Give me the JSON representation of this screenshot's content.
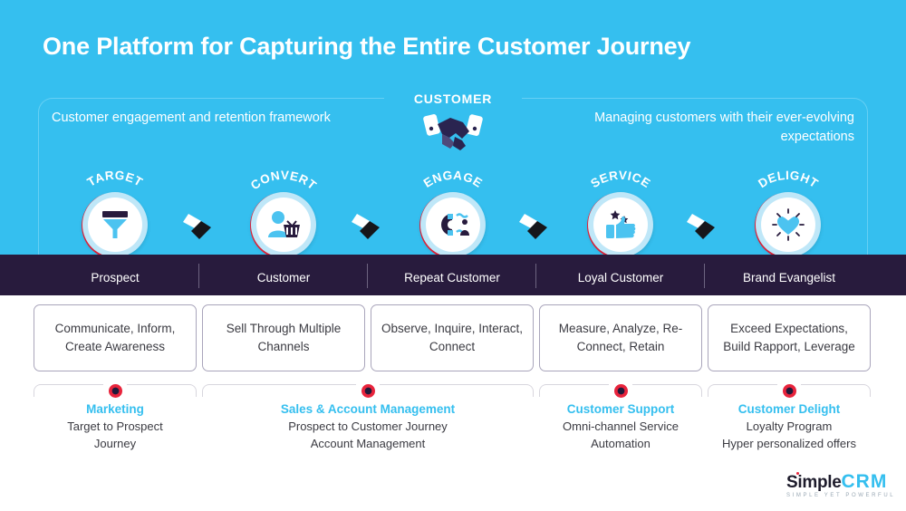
{
  "header": {
    "title": "One Platform for Capturing the Entire Customer Journey",
    "caption_left": "Customer engagement and retention framework",
    "caption_right": "Managing customers with their ever-evolving expectations",
    "center_label": "CUSTOMER",
    "center_icon": "handshake-icon"
  },
  "colors": {
    "background": "#35bfef",
    "band": "#281b3d",
    "accent_red": "#e8243c",
    "accent_cyan": "#35bfef",
    "card_border": "#a9a5bb",
    "text_dark": "#3b3b42"
  },
  "stages": [
    {
      "word": "TARGET",
      "icon": "funnel-icon",
      "label": "Prospect",
      "card": "Communicate, Inform, Create Awareness"
    },
    {
      "word": "CONVERT",
      "icon": "shopper-icon",
      "label": "Customer",
      "card": "Sell Through Multiple Channels"
    },
    {
      "word": "ENGAGE",
      "icon": "magnet-icon",
      "label": "Repeat Customer",
      "card": "Observe,  Inquire, Interact, Connect"
    },
    {
      "word": "SERVICE",
      "icon": "thumbs-up-stars-icon",
      "label": "Loyal Customer",
      "card": "Measure, Analyze, Re-Connect, Retain"
    },
    {
      "word": "DELIGHT",
      "icon": "shining-heart-icon",
      "label": "Brand Evangelist",
      "card": "Exceed Expectations, Build Rapport, Leverage"
    }
  ],
  "functions": [
    {
      "title": "Marketing",
      "lines": [
        "Target to Prospect",
        "Journey"
      ]
    },
    {
      "title": "Sales & Account Management",
      "lines": [
        "Prospect to Customer Journey",
        "Account Management"
      ]
    },
    {
      "title": "Customer Support",
      "lines": [
        "Omni-channel Service",
        "Automation"
      ]
    },
    {
      "title": "Customer Delight",
      "lines": [
        "Loyalty Program",
        "Hyper personalized offers"
      ]
    }
  ],
  "logo": {
    "name_part1": "Simple",
    "name_part2": "CRM",
    "tagline": "SIMPLE YET POWERFUL"
  }
}
